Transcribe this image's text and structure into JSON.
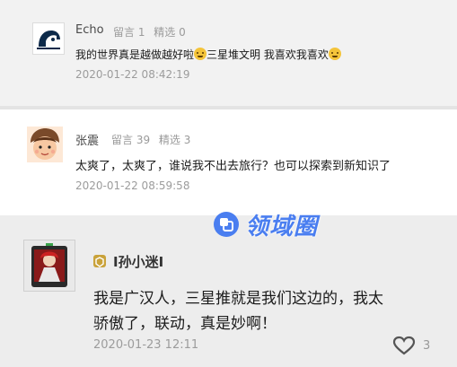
{
  "comments": [
    {
      "name": "Echo",
      "replies_label": "留言 1",
      "picks_label": "精选 0",
      "text_a": "我的世界真是越做越好啦",
      "text_b": "三星堆文明 我喜欢我喜欢",
      "time": "2020-01-22 08:42:19"
    },
    {
      "name": "张震",
      "replies_label": "留言 39",
      "picks_label": "精选 3",
      "text": "太爽了，太爽了，谁说我不出去旅行？也可以探索到新知识了",
      "time": "2020-01-22 08:59:58"
    },
    {
      "name": "I孙小迷I",
      "text_line1": "我是广汉人，三星推就是我们这边的，我太",
      "text_line2": "骄傲了，联动，真是妙啊！",
      "time": "2020-01-23 12:11",
      "likes": "3"
    }
  ],
  "watermark": {
    "text": "领域圈"
  },
  "colors": {
    "watermark": "#4a7ef0",
    "badge": "#c9a23a"
  }
}
